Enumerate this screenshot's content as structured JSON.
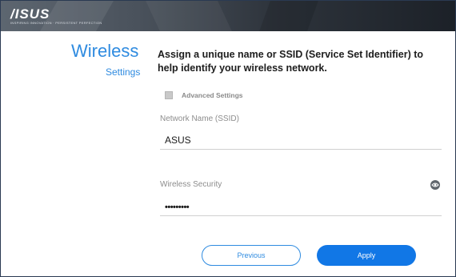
{
  "brand": {
    "logo_text": "/ISUS",
    "tagline": "INSPIRING INNOVATION · PERSISTENT PERFECTION"
  },
  "sidebar": {
    "title": "Wireless",
    "subtitle": "Settings"
  },
  "main": {
    "heading": "Assign a unique name or SSID (Service Set Identifier) to help identify your wireless network.",
    "advanced_settings_label": "Advanced Settings",
    "advanced_settings_checked": false,
    "ssid": {
      "label": "Network Name (SSID)",
      "value": "ASUS"
    },
    "security": {
      "label": "Wireless Security",
      "value": "•••••••••"
    },
    "buttons": {
      "previous": "Previous",
      "apply": "Apply"
    }
  },
  "icons": {
    "password_toggle": "eye-icon",
    "checkbox": "checkbox-icon"
  },
  "colors": {
    "accent": "#2f8be0",
    "apply_button": "#1177e6",
    "banner_dark": "#1c2128"
  }
}
